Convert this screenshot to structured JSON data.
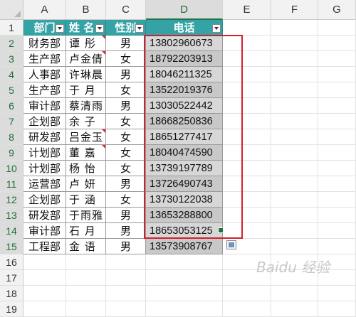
{
  "columns": [
    "A",
    "B",
    "C",
    "D",
    "E",
    "F",
    "G"
  ],
  "rows": [
    "1",
    "2",
    "3",
    "4",
    "5",
    "6",
    "7",
    "8",
    "9",
    "10",
    "11",
    "12",
    "13",
    "14",
    "15",
    "16",
    "17",
    "18",
    "19"
  ],
  "header": {
    "dept": "部门",
    "name": "姓  名",
    "gender": "性别",
    "phone": "电话"
  },
  "data": [
    {
      "dept": "财务部",
      "name": "谭  彤",
      "gender": "男",
      "phone": "13802960673"
    },
    {
      "dept": "生产部",
      "name": "卢金倩",
      "gender": "女",
      "phone": "18792203913"
    },
    {
      "dept": "人事部",
      "name": "许琳晨",
      "gender": "男",
      "phone": "18046211325"
    },
    {
      "dept": "生产部",
      "name": "于  月",
      "gender": "女",
      "phone": "13522019376"
    },
    {
      "dept": "审计部",
      "name": "蔡清雨",
      "gender": "男",
      "phone": "13030522442"
    },
    {
      "dept": "企划部",
      "name": "余  子",
      "gender": "女",
      "phone": "18668250836"
    },
    {
      "dept": "研发部",
      "name": "吕金玉",
      "gender": "女",
      "phone": "18651277417"
    },
    {
      "dept": "计划部",
      "name": "董  嘉",
      "gender": "女",
      "phone": "18040474590"
    },
    {
      "dept": "计划部",
      "name": "杨  怡",
      "gender": "女",
      "phone": "13739197789"
    },
    {
      "dept": "运营部",
      "name": "卢  妍",
      "gender": "男",
      "phone": "13726490743"
    },
    {
      "dept": "企划部",
      "name": "于  涵",
      "gender": "女",
      "phone": "13730122038"
    },
    {
      "dept": "研发部",
      "name": "于雨雅",
      "gender": "男",
      "phone": "13653288800"
    },
    {
      "dept": "审计部",
      "name": "石  月",
      "gender": "男",
      "phone": "18653053125"
    },
    {
      "dept": "工程部",
      "name": "金  语",
      "gender": "男",
      "phone": "13573908767"
    }
  ],
  "watermark": "Baidu 经验",
  "colors": {
    "table_header": "#35a3a6",
    "highlight_box": "#d1222c",
    "selection": "#217346"
  }
}
